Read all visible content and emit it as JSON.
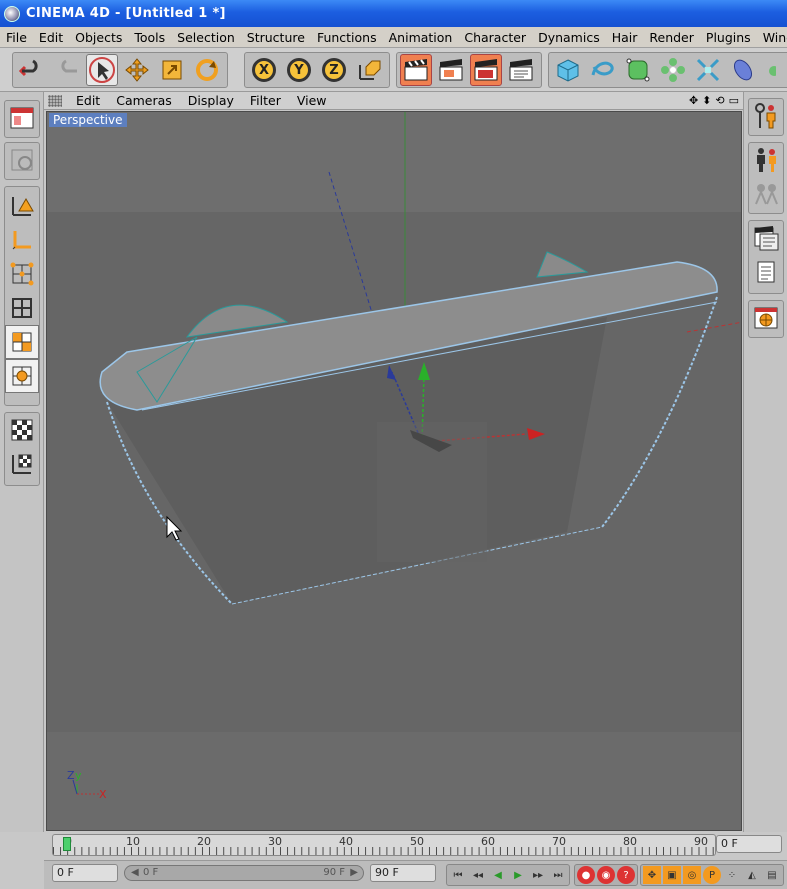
{
  "window": {
    "title": "CINEMA 4D - [Untitled 1 *]"
  },
  "menubar": [
    "File",
    "Edit",
    "Objects",
    "Tools",
    "Selection",
    "Structure",
    "Functions",
    "Animation",
    "Character",
    "Dynamics",
    "Hair",
    "Render",
    "Plugins",
    "Window"
  ],
  "toolbar": {
    "axis_lock": {
      "x": "X",
      "y": "Y",
      "z": "Z"
    }
  },
  "viewport": {
    "menus": [
      "Edit",
      "Cameras",
      "Display",
      "Filter",
      "View"
    ],
    "label": "Perspective",
    "axis_labels": {
      "z": "Z",
      "y": "y",
      "x": "X"
    }
  },
  "timeline": {
    "ticks": [
      "0",
      "10",
      "20",
      "30",
      "40",
      "50",
      "60",
      "70",
      "80",
      "90"
    ],
    "current_frame": "0 F"
  },
  "bottombar": {
    "start_frame": "0 F",
    "range_start": "0 F",
    "range_end": "90 F",
    "end_frame": "90 F"
  },
  "colors": {
    "title_bar": "#1c5ee0",
    "viewport": "#666666",
    "accent": "#f08050",
    "selection": "#5d7fbf"
  }
}
